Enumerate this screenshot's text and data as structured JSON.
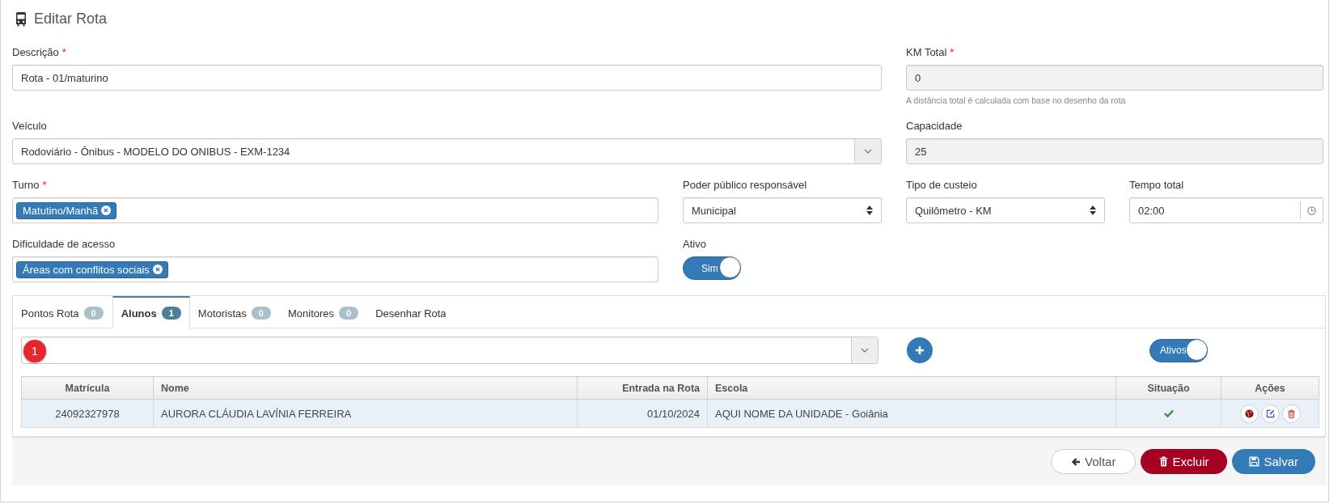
{
  "page": {
    "title": "Editar Rota"
  },
  "descricao": {
    "label": "Descrição",
    "required_mark": "*",
    "value": "Rota - 01/maturino",
    "readonly": false
  },
  "km_total": {
    "label": "KM Total",
    "required_mark": "*",
    "value": "0",
    "readonly": true,
    "help": "A distância total é calculada com base no desenho da rota"
  },
  "veiculo": {
    "label": "Veículo",
    "value": "Rodoviário - Ônibus - MODELO DO ONIBUS - EXM-1234"
  },
  "capacidade": {
    "label": "Capacidade",
    "value": "25",
    "readonly": true
  },
  "turno": {
    "label": "Turno",
    "required_mark": "*",
    "tags": [
      "Matutino/Manhã"
    ]
  },
  "poder_publico": {
    "label": "Poder público responsável",
    "value": "Municipal"
  },
  "tipo_custeio": {
    "label": "Tipo de custeio",
    "value": "Quilômetro - KM"
  },
  "tempo_total": {
    "label": "Tempo total",
    "value": "02:00"
  },
  "dificuldade": {
    "label": "Dificuldade de acesso",
    "tags": [
      "Áreas com conflitos sociais"
    ]
  },
  "ativo": {
    "label": "Ativo",
    "text": "Sim",
    "on": true
  },
  "tabs": [
    {
      "label": "Pontos Rota",
      "count": "0",
      "selected": false
    },
    {
      "label": "Alunos",
      "count": "1",
      "selected": true
    },
    {
      "label": "Motoristas",
      "count": "0",
      "selected": false
    },
    {
      "label": "Monitores",
      "count": "0",
      "selected": false
    },
    {
      "label": "Desenhar Rota",
      "selected": false
    }
  ],
  "student_picker": {
    "badge": "1"
  },
  "filter_toggle": {
    "text": "Ativos",
    "on": true
  },
  "table": {
    "columns": [
      "Matrícula",
      "Nome",
      "Entrada na Rota",
      "Escola",
      "Situação",
      "Ações"
    ],
    "rows": [
      {
        "matricula": "24092327978",
        "nome": "AURORA CLÁUDIA LAVÍNIA FERREIRA",
        "entrada": "01/10/2024",
        "escola": "AQUI NOME DA UNIDADE - Goiânia",
        "active": true
      }
    ]
  },
  "buttons": [
    {
      "label": "Voltar",
      "kind": "back"
    },
    {
      "label": "Excluir",
      "kind": "delete"
    },
    {
      "label": "Salvar",
      "kind": "save"
    }
  ]
}
